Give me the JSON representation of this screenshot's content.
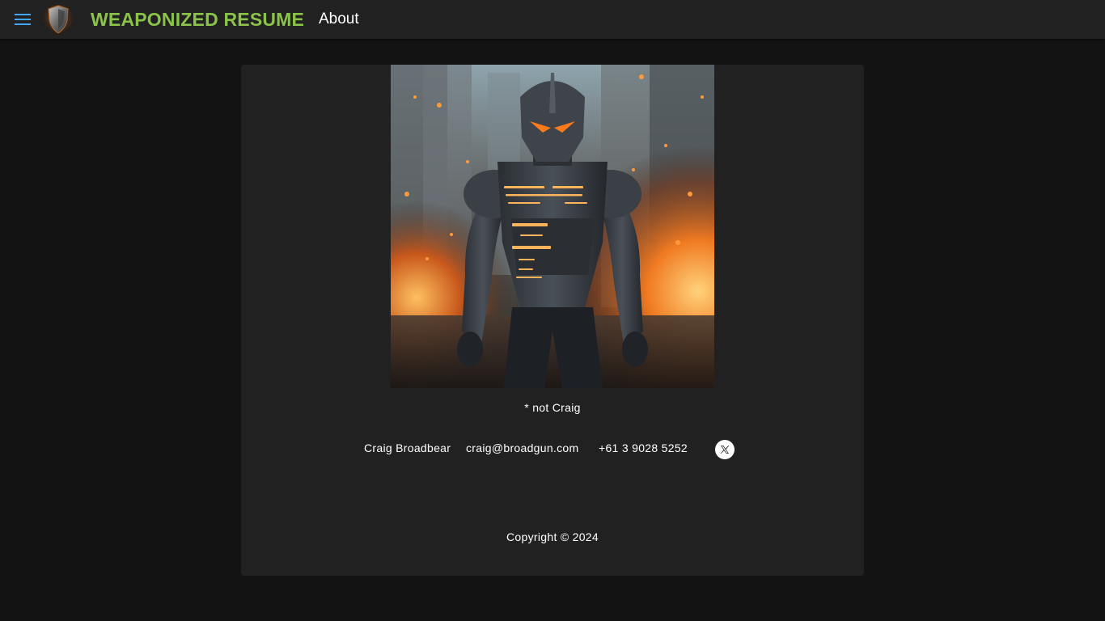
{
  "header": {
    "brand": "WEAPONIZED RESUME",
    "nav_about": "About",
    "menu_icon": "hamburger-menu-icon",
    "logo_icon": "shield-logo"
  },
  "hero": {
    "image_description_icon": "armored-robot-image"
  },
  "main": {
    "caption": "* not Craig",
    "contact": {
      "name": "Craig Broadbear",
      "email": "craig@broadgun.com",
      "phone": "+61 3 9028 5252",
      "social_icon": "x-twitter-icon"
    },
    "copyright": "Copyright © 2024"
  },
  "colors": {
    "background": "#131313",
    "surface": "#212121",
    "brand": "#8bc34a",
    "menu_icon": "#42a5f5"
  }
}
